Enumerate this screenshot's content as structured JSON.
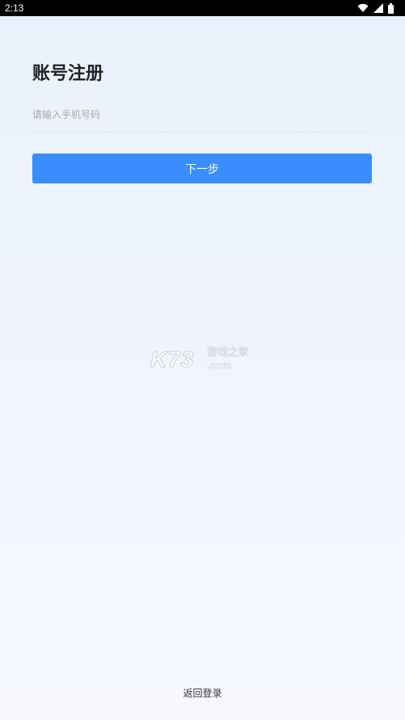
{
  "status_bar": {
    "time": "2:13",
    "icons": [
      "wifi-icon",
      "signal-icon",
      "battery-icon"
    ]
  },
  "register": {
    "title": "账号注册",
    "phone_placeholder": "请输入手机号码",
    "phone_value": "",
    "next_label": "下一步",
    "back_login_label": "返回登录"
  },
  "watermark": {
    "main": "K73",
    "cn": "游戏之家",
    "com": ".com"
  },
  "colors": {
    "primary": "#3a8dfd",
    "background_top": "#e9f1fc",
    "background_bottom": "#f6f8fe",
    "title_text": "#222222",
    "placeholder_text": "#a8a8a8"
  }
}
